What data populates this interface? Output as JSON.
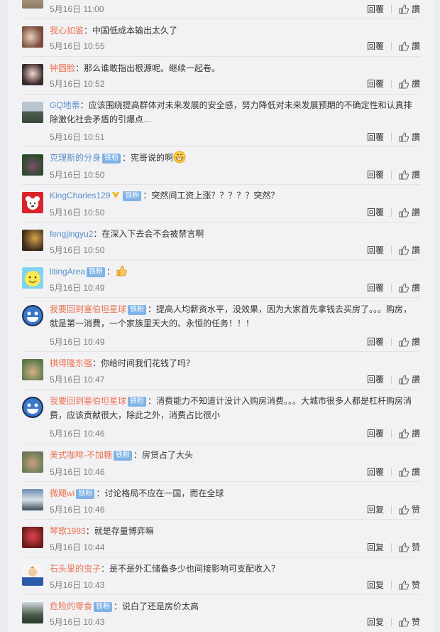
{
  "actions": {
    "reply_label": "回覆",
    "like_label_trad": "讚",
    "like_label": "赞"
  },
  "comments": [
    {
      "user": "",
      "badge": "",
      "text": "",
      "time": "5月16日 11:00",
      "like": "讚"
    },
    {
      "user": "我心如鉴",
      "badge": "",
      "text": "：中国低成本输出太久了",
      "time": "5月16日 10:55",
      "like": "讚"
    },
    {
      "user": "钟圆脸",
      "badge": "",
      "text": "：那么谁敢指出根源呢。继续一起卷。",
      "time": "5月16日 10:52",
      "like": "讚"
    },
    {
      "user": "GQ地蒂",
      "badge": "",
      "text": "：应该围绕提高群体对未来发展的安全感，努力降低对未来发展预期的不确定性和认真排除激化社会矛盾的引爆点…",
      "time": "5月16日 10:51",
      "like": "讚"
    },
    {
      "user": "克理斯的分身",
      "badge": "铁粉",
      "text": "：宪哥说的啊",
      "time": "5月16日 10:50",
      "like": "讚"
    },
    {
      "user": "KingCharles129",
      "badge": "铁粉",
      "text": "：突然间工资上涨？？？？？突然？",
      "time": "5月16日 10:50",
      "like": "讚"
    },
    {
      "user": "fengjingyu2",
      "badge": "",
      "text": "：在深入下去会不会被禁言啊",
      "time": "5月16日 10:50",
      "like": "讚"
    },
    {
      "user": "litingArea",
      "badge": "铁粉",
      "text": "：",
      "time": "5月16日 10:49",
      "like": "讚"
    },
    {
      "user": "我要回到塞伯坦星球",
      "badge": "铁粉",
      "text": "：提高人均薪资水平，没效果，因为大家首先拿钱去买房了。。。购房，就是第一消費，一个家族里天大的、永恒的任务！！！",
      "time": "5月16日 10:49",
      "like": "讚"
    },
    {
      "user": "棋得隆东强",
      "badge": "",
      "text": "：你给时间我们花钱了吗？",
      "time": "5月16日 10:47",
      "like": "讚"
    },
    {
      "user": "我要回到塞伯坦星球",
      "badge": "铁粉",
      "text": "：消费能力不知道计没计入购房消费。。。大城市很多人都是杠杆购房消费，应该贡献很大，除此之外，消费占比很小",
      "time": "5月16日 10:46",
      "like": "讚"
    },
    {
      "user": "美式咖啡-不加糖",
      "badge": "铁粉",
      "text": "：房贷占了大头",
      "time": "5月16日 10:46",
      "like": "讚"
    },
    {
      "user": "微飓wi",
      "badge": "铁粉",
      "text": "：讨论格局不应在一国，而在全球",
      "time": "5月16日 10:46",
      "like": "赞"
    },
    {
      "user": "琴歌1983",
      "badge": "",
      "text": "：就是存量博弈嘛",
      "time": "5月16日 10:44",
      "like": "赞"
    },
    {
      "user": "石头里的虫子",
      "badge": "",
      "text": "：是不是外汇储备多少也间接影响可支配收入？",
      "time": "5月16日 10:43",
      "like": "赞"
    },
    {
      "user": "危险的零食",
      "badge": "铁粉",
      "text": "：说白了还是房价太高",
      "time": "5月16日 10:43",
      "like": "赞"
    }
  ],
  "reply_label": "回覆",
  "reply_label_alt": "回复",
  "colors": {
    "username": "#eb7350",
    "badge": "#7fb2e5",
    "time": "#808080"
  }
}
